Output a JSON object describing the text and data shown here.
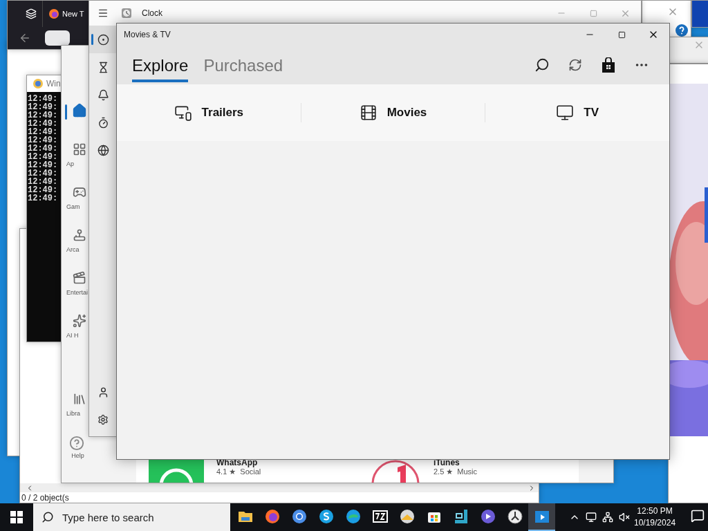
{
  "firefox": {
    "tab_title": "New T"
  },
  "console": {
    "title": "Win",
    "lines": [
      "12:49:",
      "12:49:",
      "12:49:",
      "12:49:",
      "12:49:",
      "12:49:",
      "12:49:",
      "12:49:",
      "12:49:",
      "12:49:",
      "12:49:",
      "12:49:",
      "12:49:"
    ]
  },
  "file_window": {
    "status": "0 / 2 object(s"
  },
  "store": {
    "nav": [
      {
        "kind": "home",
        "selected": true
      },
      {
        "kind": "apps",
        "label": "Ap",
        "selected": false
      },
      {
        "kind": "gaming",
        "label": "Gam",
        "selected": false
      },
      {
        "kind": "arcade",
        "label": "Arca",
        "selected": false
      },
      {
        "kind": "entertainment",
        "label": "Entertai",
        "selected": false
      },
      {
        "kind": "ai",
        "label": "AI H",
        "selected": false
      }
    ],
    "library": "Libra",
    "help": "Help",
    "apps": [
      {
        "kind": "whatsapp",
        "name": "WhatsApp",
        "meta": "4.1 ★  Social"
      },
      {
        "kind": "itunes",
        "name": "iTunes",
        "meta": "2.5 ★  Music"
      }
    ]
  },
  "clock": {
    "title": "Clock",
    "nav": [
      {
        "kind": "focus",
        "selected": true
      },
      {
        "kind": "timer",
        "selected": false
      },
      {
        "kind": "alarm",
        "selected": false
      },
      {
        "kind": "stopwatch",
        "selected": false
      },
      {
        "kind": "world",
        "selected": false
      }
    ]
  },
  "movies_tv": {
    "title": "Movies & TV",
    "tabs": [
      {
        "label": "Explore",
        "selected": true
      },
      {
        "label": "Purchased",
        "selected": false
      }
    ],
    "categories": [
      {
        "kind": "trailers",
        "label": "Trailers"
      },
      {
        "kind": "movies",
        "label": "Movies"
      },
      {
        "kind": "tv",
        "label": "TV"
      }
    ]
  },
  "taskbar": {
    "search_placeholder": "Type here to search",
    "apps": [
      {
        "kind": "files",
        "active": false
      },
      {
        "kind": "firefox",
        "active": false
      },
      {
        "kind": "chrome",
        "active": false
      },
      {
        "kind": "skype",
        "active": false
      },
      {
        "kind": "edge",
        "active": false
      },
      {
        "kind": "sevenzip",
        "active": false
      },
      {
        "kind": "photos",
        "active": false
      },
      {
        "kind": "store",
        "active": false
      },
      {
        "kind": "device",
        "active": false
      },
      {
        "kind": "copilot",
        "active": false
      },
      {
        "kind": "clock",
        "active": false
      },
      {
        "kind": "movies",
        "active": true
      }
    ],
    "time": "12:50 PM",
    "date": "10/19/2024"
  }
}
